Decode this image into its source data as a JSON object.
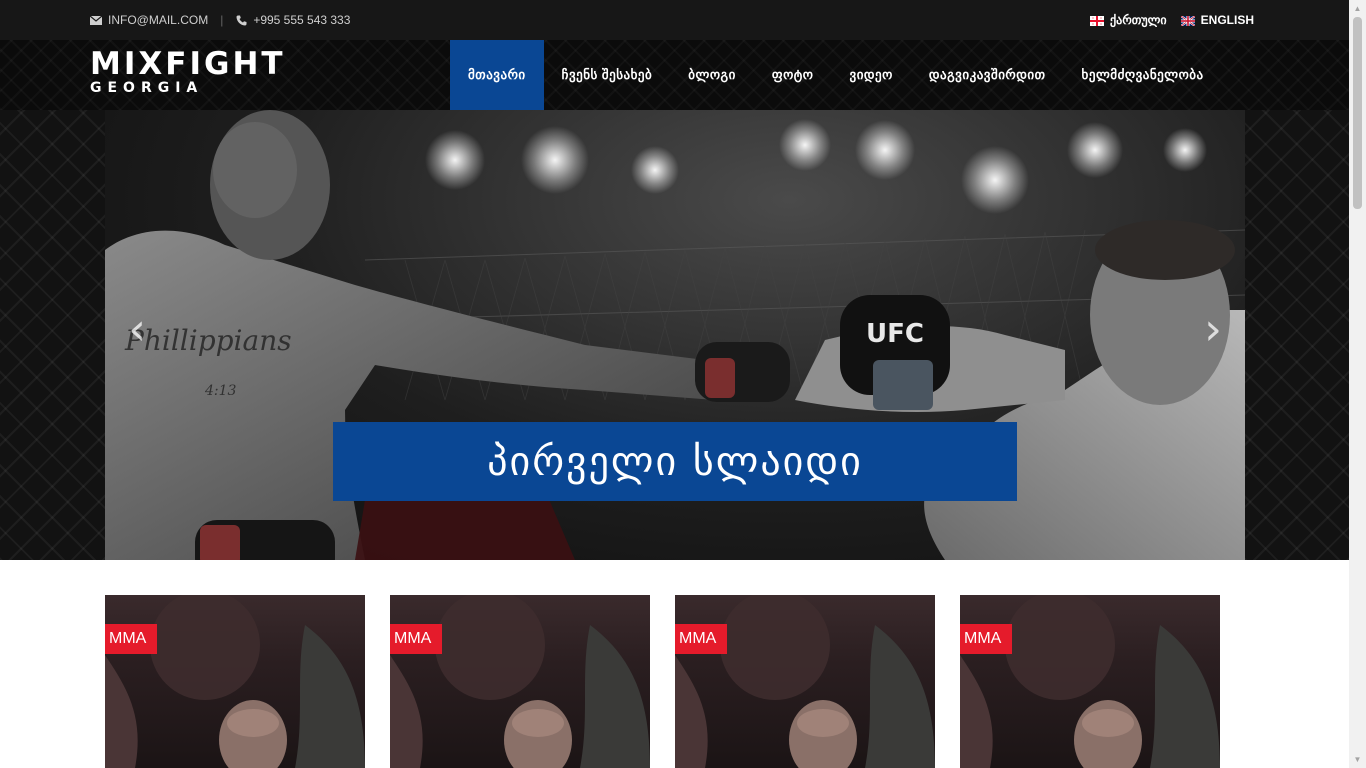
{
  "topbar": {
    "email": "INFO@MAIL.COM",
    "phone": "+995 555 543 333",
    "separator": "|",
    "languages": [
      {
        "label": "ქართული",
        "flag": "georgia-flag-icon"
      },
      {
        "label": "ENGLISH",
        "flag": "uk-flag-icon"
      }
    ]
  },
  "logo": {
    "line1": "MIXFIGHT",
    "line2": "GEORGIA"
  },
  "nav": {
    "items": [
      {
        "label": "მთავარი",
        "active": true
      },
      {
        "label": "ჩვენს შესახებ",
        "active": false
      },
      {
        "label": "ბლოგი",
        "active": false
      },
      {
        "label": "ფოტო",
        "active": false
      },
      {
        "label": "ვიდეო",
        "active": false
      },
      {
        "label": "დაგვიკავშირდით",
        "active": false
      },
      {
        "label": "ხელმძღვანელობა",
        "active": false
      }
    ]
  },
  "slider": {
    "caption": "პირველი სლაიდი",
    "prev": "‹",
    "next": "›",
    "glove_text": "UFC"
  },
  "posts": [
    {
      "tag": "MMA"
    },
    {
      "tag": "MMA"
    },
    {
      "tag": "MMA"
    },
    {
      "tag": "MMA"
    }
  ],
  "colors": {
    "accent": "#0a4794",
    "tag": "#e51b2b",
    "topbar": "#171717"
  }
}
